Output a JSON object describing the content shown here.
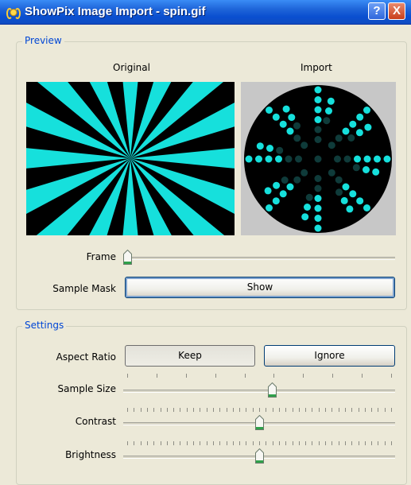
{
  "window": {
    "title": "ShowPix Image Import - spin.gif",
    "help_button": "?",
    "close_button": "X"
  },
  "preview": {
    "legend": "Preview",
    "original_label": "Original",
    "import_label": "Import",
    "frame_label": "Frame",
    "frame_value": 0.0,
    "sample_mask_label": "Sample Mask",
    "show_button": "Show"
  },
  "settings": {
    "legend": "Settings",
    "aspect_ratio_label": "Aspect Ratio",
    "keep_button": "Keep",
    "ignore_button": "Ignore",
    "sample_size_label": "Sample Size",
    "sample_size_value": 0.55,
    "contrast_label": "Contrast",
    "contrast_value": 0.5,
    "brightness_label": "Brightness",
    "brightness_value": 0.5
  },
  "colors": {
    "accent": "#16e0dc",
    "legend_text": "#0046d5",
    "thumb_green": "#2fa14a"
  },
  "icons": {
    "app": "broadcast-icon",
    "help": "help-icon",
    "close": "close-icon"
  }
}
